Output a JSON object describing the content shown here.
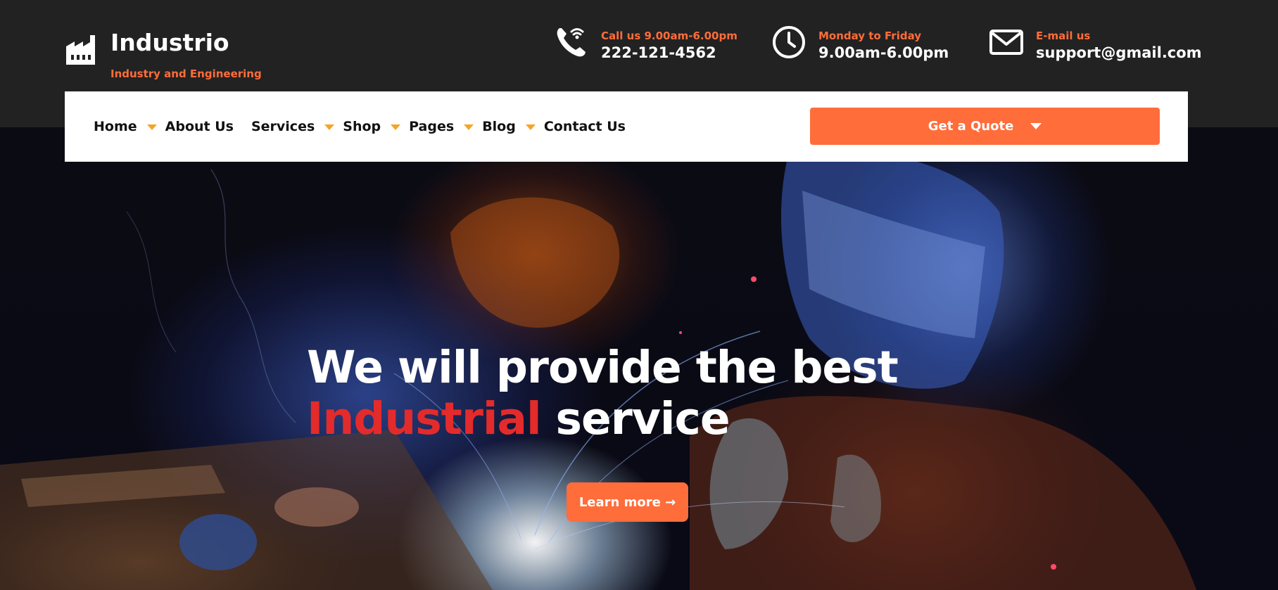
{
  "brand": {
    "name": "Industrio",
    "tagline": "Industry and Engineering",
    "icon": "factory-icon"
  },
  "contacts": [
    {
      "icon": "phone-icon",
      "label": "Call us 9.00am-6.00pm",
      "value": "222-121-4562"
    },
    {
      "icon": "clock-icon",
      "label": "Monday to Friday",
      "value": "9.00am-6.00pm"
    },
    {
      "icon": "mail-icon",
      "label": "E-mail us",
      "value": "support@gmail.com"
    }
  ],
  "nav": {
    "items": [
      {
        "label": "Home",
        "has_dropdown": true
      },
      {
        "label": "About Us",
        "has_dropdown": false
      },
      {
        "label": "Services",
        "has_dropdown": true
      },
      {
        "label": "Shop",
        "has_dropdown": true
      },
      {
        "label": "Pages",
        "has_dropdown": true
      },
      {
        "label": "Blog",
        "has_dropdown": true
      },
      {
        "label": "Contact Us",
        "has_dropdown": false
      }
    ],
    "quote_label": "Get a Quote"
  },
  "hero": {
    "title_line1": "We will provide the best",
    "title_accent": "Industrial",
    "title_rest": " service",
    "cta_label": "Learn more →"
  },
  "colors": {
    "topbar_bg": "#222222",
    "accent_orange": "#ff6d3a",
    "caret_yellow": "#f7a325",
    "hero_accent_red": "#e32b2b"
  }
}
